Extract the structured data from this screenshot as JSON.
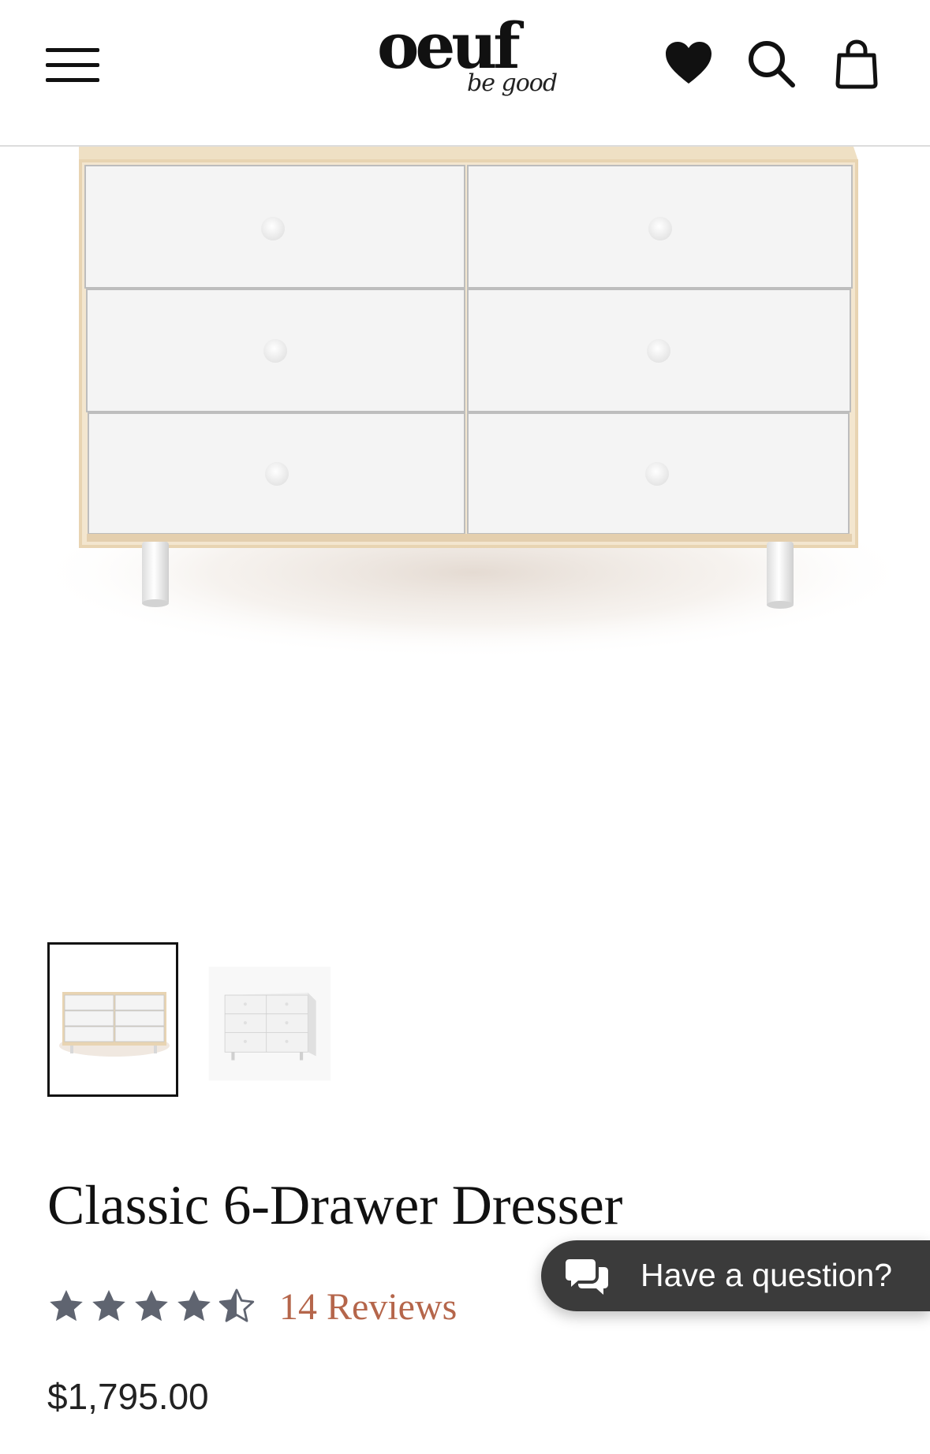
{
  "header": {
    "logo": {
      "main": "oeuf",
      "tagline": "be good"
    },
    "icons": [
      "menu-icon",
      "heart-icon",
      "search-icon",
      "shopping-bag-icon"
    ]
  },
  "gallery": {
    "thumbnail_count": 2,
    "active_index": 0
  },
  "product": {
    "title": "Classic 6-Drawer Dresser",
    "rating": 4.5,
    "rating_max": 5,
    "reviews_label": "14 Reviews",
    "price": "$1,795.00"
  },
  "chat": {
    "label": "Have a question?"
  },
  "colors": {
    "accent_reviews": "#b5664b",
    "star": "#5f6470",
    "chat_bg": "#3b3b3b"
  }
}
